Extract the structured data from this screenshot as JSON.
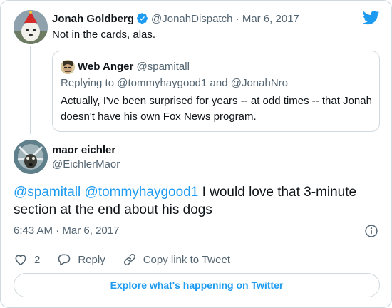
{
  "parent_tweet": {
    "author_name": "Jonah Goldberg",
    "author_handle": "@JonahDispatch",
    "date": "Mar 6, 2017",
    "date_separator": "·",
    "text": "Not in the cards, alas."
  },
  "quoted_tweet": {
    "author_name": "Web Anger",
    "author_handle": "@spamitall",
    "replying_prefix": "Replying to",
    "replying_user1": "@tommyhaygood1",
    "replying_and": "and",
    "replying_user2": "@JonahNro",
    "text": "Actually, I've been surprised for years -- at odd times -- that Jonah doesn't have his own Fox News program."
  },
  "main_tweet": {
    "author_name": "maor eichler",
    "author_handle": "@EichlerMaor",
    "mention1": "@spamitall",
    "mention2": "@tommyhaygood1",
    "text": " I would love that 3-minute section at the end about his dogs",
    "time": "6:43 AM",
    "date_separator": "·",
    "date": "Mar 6, 2017"
  },
  "actions": {
    "like_count": "2",
    "reply_label": "Reply",
    "copy_link_label": "Copy link to Tweet"
  },
  "explore_label": "Explore what's happening on Twitter",
  "colors": {
    "accent": "#1d9bf0",
    "muted": "#536471",
    "border": "#cfd9de",
    "text": "#0f1419"
  },
  "icons": {
    "brand": "twitter-bird-icon",
    "verified": "verified-badge-icon",
    "info": "info-icon",
    "like": "heart-icon",
    "reply": "speech-bubble-icon",
    "copy_link": "link-icon"
  }
}
